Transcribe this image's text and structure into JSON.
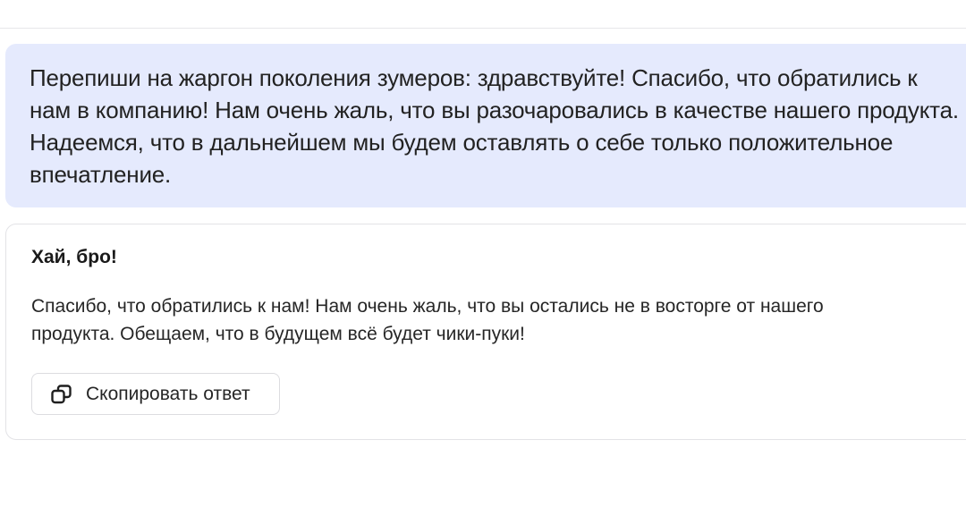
{
  "user_message": {
    "text": "Перепиши на жаргон поколения зумеров: здравствуйте! Спасибо, что обратились к нам в компанию! Нам очень жаль, что вы разочаровались в качестве нашего продукта. Надеемся, что в дальнейшем мы будем оставлять о себе только положительное впечатление."
  },
  "assistant_answer": {
    "greeting": "Хай, бро!",
    "body": "Спасибо, что обратились к нам! Нам очень жаль, что вы остались не в восторге от нашего продукта. Обещаем, что в будущем всё будет чики-пуки!",
    "copy_button": {
      "label": "Скопировать ответ",
      "icon": "copy-icon"
    }
  }
}
